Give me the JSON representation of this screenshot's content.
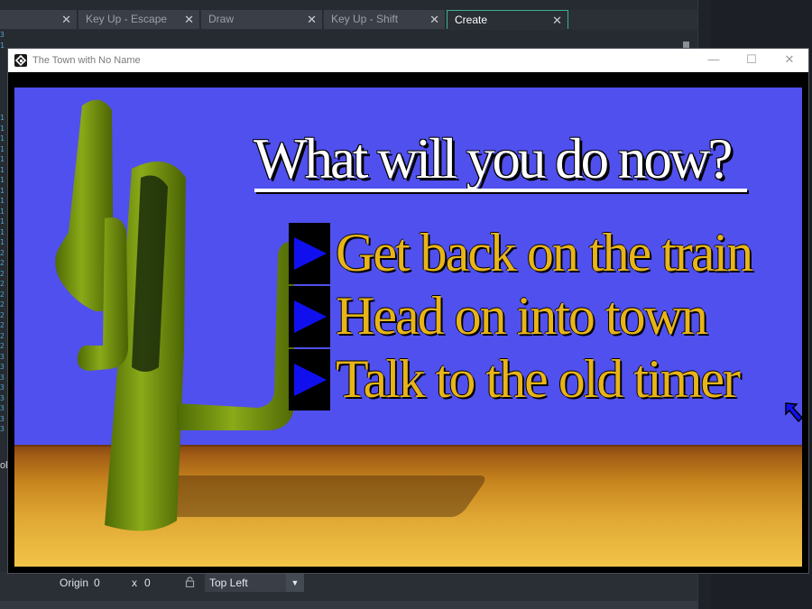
{
  "ide": {
    "tabs": [
      {
        "label": "",
        "close": "✕"
      },
      {
        "label": "Key Up - Escape",
        "close": "✕"
      },
      {
        "label": "Draw",
        "close": "✕"
      },
      {
        "label": "Key Up - Shift",
        "close": "✕"
      },
      {
        "label": "Create",
        "close": "✕"
      }
    ],
    "line_numbers": "3\n1\n\n\n\n\n\n\n1\n1\n1\n1\n1\n1\n1\n1\n1\n1\n1\n1\n1\n2\n2\n2\n2\n2\n2\n2\n2\n2\n2\n3\n3\n3\n3\n3\n3\n3\n3",
    "side_label": "ol",
    "origin_label": "Origin",
    "origin_value": "0",
    "x_label": "x",
    "x_value": "0",
    "anchor_select": "Top Left"
  },
  "window": {
    "title": "The Town with No Name",
    "minimize": "—",
    "maximize": "☐",
    "close": "✕"
  },
  "game": {
    "heading": "What will you do now?",
    "choices": [
      "Get back on the train",
      "Head on into town",
      "Talk to the old timer"
    ]
  },
  "colors": {
    "sky": "#5050ee",
    "choice_text": "#e8b418",
    "arrow": "#1010ee",
    "cactus": "#7a9a10",
    "active_tab_border": "#3bb38b"
  }
}
